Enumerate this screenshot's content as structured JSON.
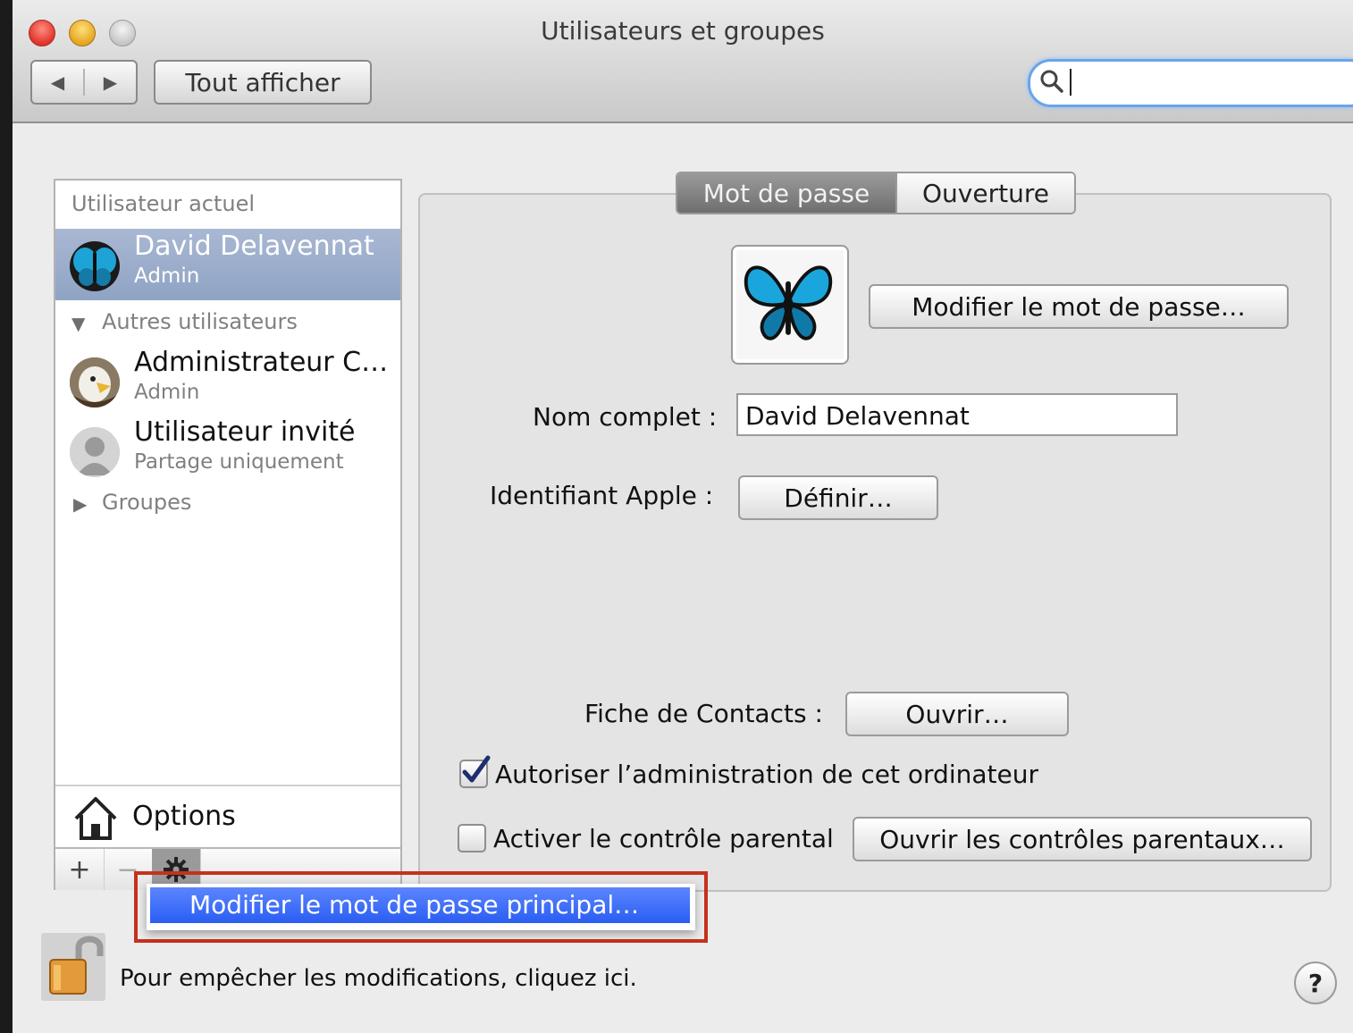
{
  "window": {
    "title": "Utilisateurs et groupes"
  },
  "toolbar": {
    "back_label": "◀",
    "forward_label": "▶",
    "show_all_label": "Tout afficher",
    "search_value": ""
  },
  "sidebar": {
    "current_user_header": "Utilisateur actuel",
    "current_user": {
      "name": "David Delavennat",
      "role": "Admin"
    },
    "other_users_header": "Autres utilisateurs",
    "other_users": [
      {
        "name": "Administrateur C…",
        "role": "Admin"
      },
      {
        "name": "Utilisateur invité",
        "role": "Partage uniquement"
      }
    ],
    "groups_header": "Groupes",
    "options_label": "Options",
    "add_label": "+",
    "remove_label": "−"
  },
  "action_menu": {
    "item_label": "Modifier le mot de passe principal…"
  },
  "tabs": {
    "password": "Mot de passe",
    "login": "Ouverture"
  },
  "main": {
    "change_password_label": "Modifier le mot de passe…",
    "full_name_label": "Nom complet :",
    "full_name_value": "David Delavennat",
    "apple_id_label": "Identifiant Apple :",
    "apple_id_button": "Définir…",
    "contacts_label": "Fiche de Contacts :",
    "contacts_button": "Ouvrir…",
    "allow_admin_label": "Autoriser l’administration de cet ordinateur",
    "allow_admin_checked": true,
    "parental_label": "Activer le contrôle parental",
    "parental_checked": false,
    "parental_button": "Ouvrir les contrôles parentaux…"
  },
  "footer": {
    "lock_text": "Pour empêcher les modifications, cliquez ici.",
    "help_label": "?"
  },
  "colors": {
    "selection": "#9aabc9",
    "menu_highlight": "#2f62f3",
    "callout_border": "#c6311c",
    "focus_ring": "#6aa4e8"
  }
}
